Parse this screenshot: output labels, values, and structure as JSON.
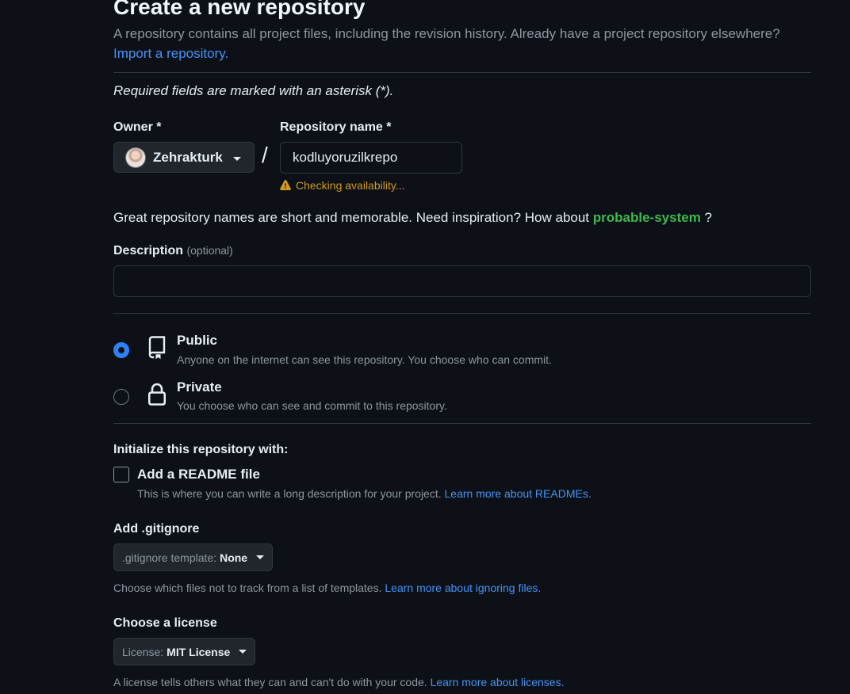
{
  "header": {
    "title": "Create a new repository",
    "subtitle": "A repository contains all project files, including the revision history. Already have a project repository elsewhere?",
    "import_link": "Import a repository."
  },
  "form": {
    "required_note": "Required fields are marked with an asterisk (*).",
    "owner": {
      "label": "Owner *",
      "value": "Zehrakturk"
    },
    "separator": "/",
    "repo_name": {
      "label": "Repository name *",
      "value": "kodluyoruzilkrepo",
      "status": "Checking availability...",
      "status_color": "#d29922"
    },
    "inspiration": {
      "prefix": "Great repository names are short and memorable. Need inspiration? How about",
      "suggestion": "probable-system",
      "suffix": "?"
    },
    "description": {
      "label": "Description",
      "optional": "(optional)",
      "value": ""
    },
    "visibility": {
      "selected": "public",
      "public": {
        "title": "Public",
        "desc": "Anyone on the internet can see this repository. You choose who can commit."
      },
      "private": {
        "title": "Private",
        "desc": "You choose who can see and commit to this repository."
      }
    },
    "initialize": {
      "heading": "Initialize this repository with:",
      "readme": {
        "label": "Add a README file",
        "checked": false,
        "help": "This is where you can write a long description for your project.",
        "help_link": "Learn more about READMEs."
      }
    },
    "gitignore": {
      "heading": "Add .gitignore",
      "select_prefix": ".gitignore template:",
      "select_value": "None",
      "help": "Choose which files not to track from a list of templates.",
      "help_link": "Learn more about ignoring files."
    },
    "license": {
      "heading": "Choose a license",
      "select_prefix": "License:",
      "select_value": "MIT License",
      "help": "A license tells others what they can and can't do with your code.",
      "help_link": "Learn more about licenses."
    }
  },
  "icons": {
    "public": "repo-icon",
    "private": "lock-icon",
    "warning": "alert-icon",
    "dropdown": "triangle-down-icon"
  },
  "colors": {
    "background": "#0d1117",
    "link": "#4493f8",
    "accent": "#2f81f7",
    "suggestion": "#3fb950",
    "warning": "#d29922"
  }
}
